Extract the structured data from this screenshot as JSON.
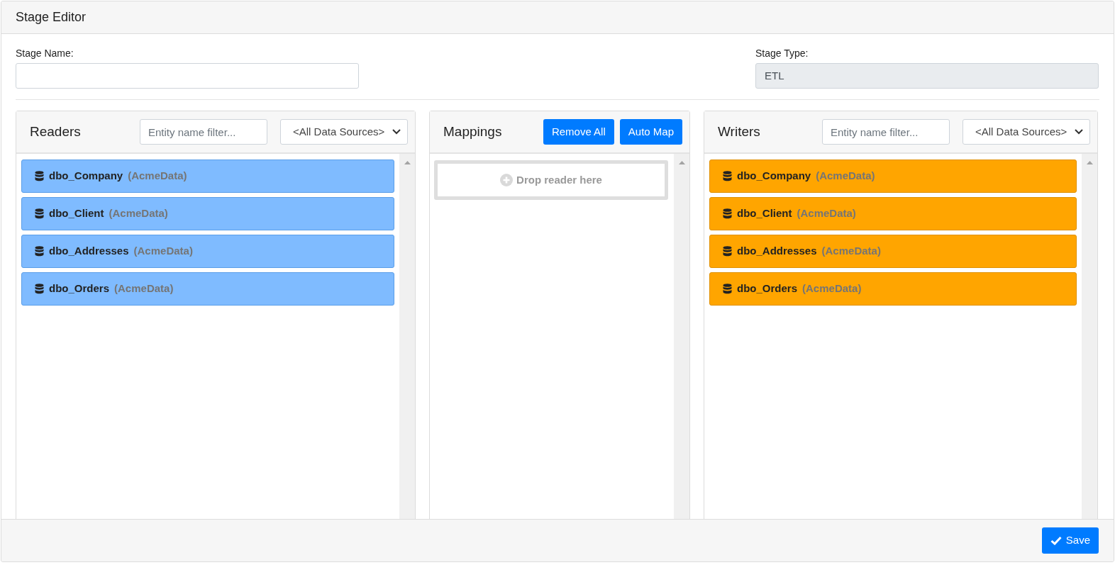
{
  "window": {
    "title": "Stage Editor"
  },
  "form": {
    "stage_name": {
      "label": "Stage Name:"
    },
    "stage_type": {
      "label": "Stage Type:",
      "value": "ETL",
      "disabled": true
    }
  },
  "panels": [
    {
      "kind": "readers",
      "title": "Readers",
      "filter": {
        "placeholder": "Entity name filter..."
      },
      "source": "<All Data Sources>",
      "items": [
        {
          "name": "dbo_Company",
          "source": "(AcmeData)"
        },
        {
          "name": "dbo_Client",
          "source": "(AcmeData)"
        },
        {
          "name": "dbo_Addresses",
          "source": "(AcmeData)"
        },
        {
          "name": "dbo_Orders",
          "source": "(AcmeData)"
        }
      ]
    },
    {
      "kind": "mappings",
      "title": "Mappings",
      "buttons": [
        "Remove All",
        "Auto Map"
      ],
      "drop_zone": "Drop reader here"
    },
    {
      "kind": "writers",
      "title": "Writers",
      "filter": {
        "placeholder": "Entity name filter..."
      },
      "source": "<All Data Sources>",
      "items": [
        {
          "name": "dbo_Company",
          "source": "(AcmeData)"
        },
        {
          "name": "dbo_Client",
          "source": "(AcmeData)"
        },
        {
          "name": "dbo_Addresses",
          "source": "(AcmeData)"
        },
        {
          "name": "dbo_Orders",
          "source": "(AcmeData)"
        }
      ]
    }
  ],
  "footer": {
    "save": "Save"
  }
}
